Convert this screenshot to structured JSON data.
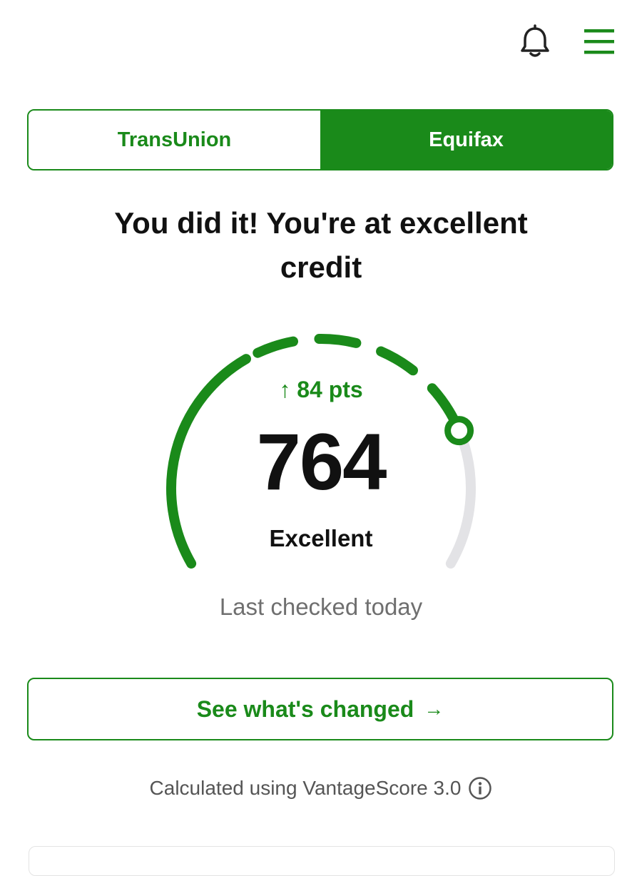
{
  "header": {
    "notifications_icon": "bell-icon",
    "menu_icon": "hamburger-menu-icon"
  },
  "bureau_tabs": [
    {
      "label": "TransUnion",
      "selected": false
    },
    {
      "label": "Equifax",
      "selected": true
    }
  ],
  "headline": {
    "line1": "You did it! You're at excellent",
    "line2": "credit"
  },
  "score_gauge": {
    "score": "764",
    "change": "84 pts",
    "change_direction": "up",
    "rating": "Excellent",
    "fill_fraction": 0.78,
    "segments": 5
  },
  "last_checked": "Last checked today",
  "cta_button": {
    "label": "See what's changed",
    "arrow": "→"
  },
  "footnote": {
    "text": "Calculated using VantageScore 3.0",
    "icon": "info-icon"
  },
  "colors": {
    "accent": "#1a8a1a",
    "track": "#e3e3e6",
    "text": "#111111",
    "muted": "#6f6f6f"
  }
}
